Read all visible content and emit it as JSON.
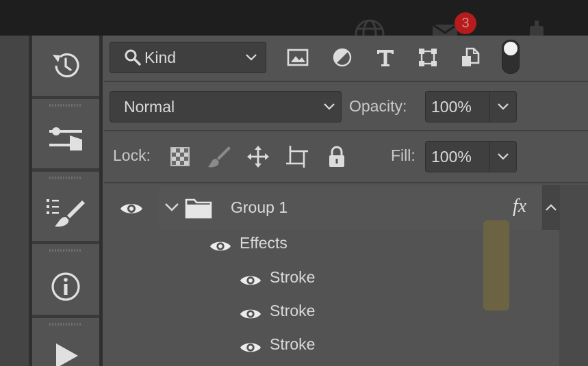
{
  "colors": {
    "app_bg": "#535353",
    "topbar": "#1e1e1e",
    "notification_badge": "#c62828",
    "layer_thumb": "#6b6341"
  },
  "topbar": {
    "icons": [
      "globe-icon",
      "notification-icon",
      "share-icon"
    ],
    "notification_count": "3"
  },
  "tool_strip": {
    "items": [
      "history-icon",
      "adjustments-icon",
      "brush-presets-icon",
      "info-icon",
      "play-actions-icon"
    ]
  },
  "filter_bar": {
    "kind_label": "Kind",
    "filter_icons": [
      "image-filter-icon",
      "adjustment-filter-icon",
      "type-filter-icon",
      "shape-filter-icon",
      "smart-object-filter-icon",
      "filter-toggle"
    ]
  },
  "blend": {
    "mode": "Normal",
    "opacity_label": "Opacity:",
    "opacity_value": "100%",
    "fill_label": "Fill:",
    "fill_value": "100%"
  },
  "lock": {
    "label": "Lock:",
    "icons": [
      "lock-transparent-pixels-icon",
      "lock-image-pixels-icon",
      "lock-position-icon",
      "lock-artboard-icon",
      "lock-all-icon"
    ]
  },
  "layers": {
    "group": {
      "name": "Group 1",
      "fx": "fx"
    },
    "effects_label": "Effects",
    "strokes": [
      "Stroke",
      "Stroke",
      "Stroke"
    ]
  }
}
